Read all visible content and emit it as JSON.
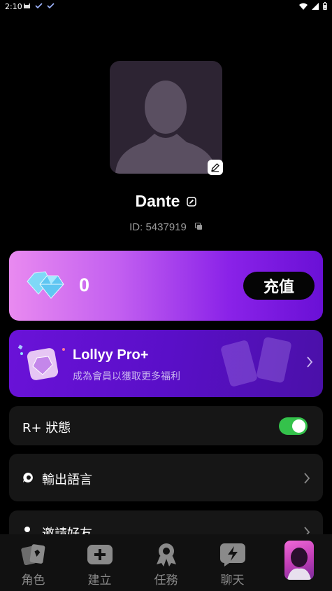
{
  "status_bar": {
    "time": "2:10"
  },
  "profile": {
    "username": "Dante",
    "id_text": "ID: 5437919"
  },
  "diamonds": {
    "count": "0",
    "recharge_label": "充值"
  },
  "pro": {
    "title": "Lollyy Pro+",
    "subtitle": "成為會員以獲取更多福利"
  },
  "settings": {
    "rplus_label": "R+ 狀態",
    "rplus_enabled": true,
    "language_label": "輸出語言",
    "invite_label": "邀請好友"
  },
  "nav": {
    "items": [
      {
        "label": "角色",
        "icon": "cards-icon"
      },
      {
        "label": "建立",
        "icon": "add-icon"
      },
      {
        "label": "任務",
        "icon": "badge-icon"
      },
      {
        "label": "聊天",
        "icon": "chat-lightning-icon"
      },
      {
        "label": "",
        "icon": "profile-avatar"
      }
    ]
  },
  "colors": {
    "toggle_on": "#34c24b",
    "diamond_card_gradient_start": "#e98af0",
    "diamond_card_gradient_end": "#6a10d6",
    "pro_card": "#5a0fc8"
  }
}
